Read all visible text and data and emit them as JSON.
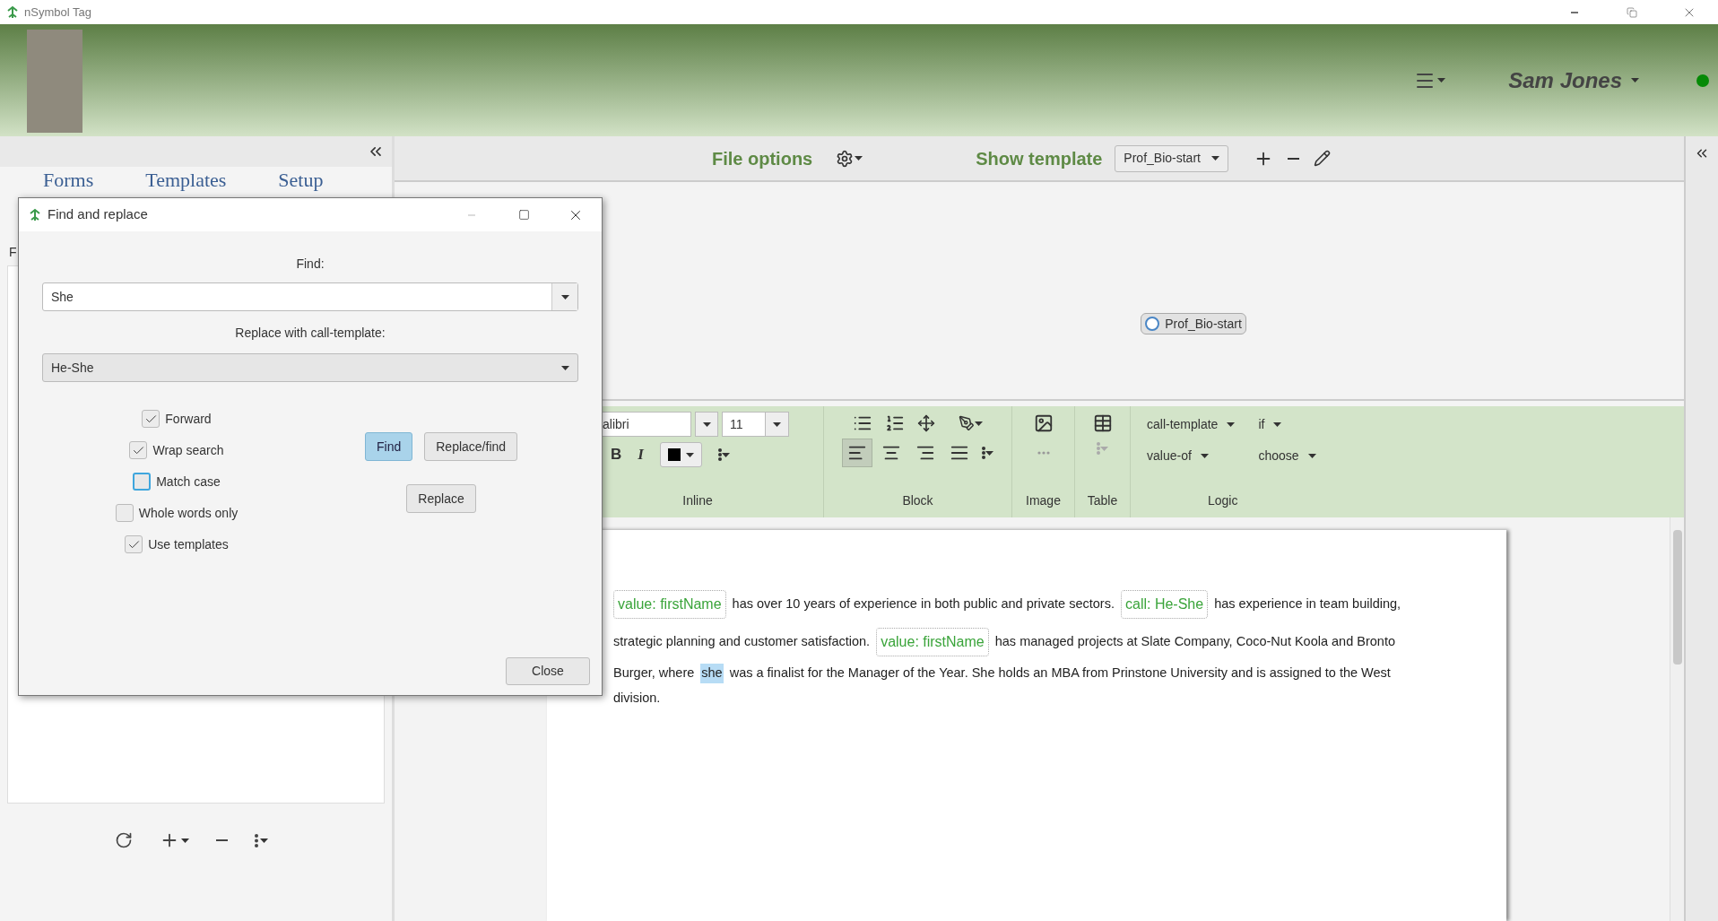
{
  "app_title": "nSymbol Tag",
  "header": {
    "user": "Sam Jones",
    "online": true
  },
  "left_panel": {
    "tabs": [
      "Forms",
      "Templates",
      "Setup"
    ],
    "partial_label": "F"
  },
  "main": {
    "file_options": "File options",
    "show_template": "Show template",
    "template_select": "Prof_Bio-start",
    "template_node": "Prof_Bio-start"
  },
  "toolbar": {
    "font": "alibri",
    "size": "11",
    "bold": "B",
    "italic": "I",
    "alignments": [
      {
        "kind": "left",
        "selected": true
      },
      {
        "kind": "center",
        "selected": false
      },
      {
        "kind": "right",
        "selected": false
      },
      {
        "kind": "justify",
        "selected": false
      }
    ],
    "logic": [
      "call-template",
      "if",
      "value-of",
      "choose"
    ],
    "groups": [
      "Inline",
      "Block",
      "Image",
      "Table",
      "Logic"
    ]
  },
  "document": {
    "lines": [
      [
        {
          "kind": "chip",
          "text": "value: firstName"
        },
        {
          "kind": "text",
          "text": "has over 10 years of experience in both public and private sectors."
        },
        {
          "kind": "chip",
          "text": "call: He-She"
        },
        {
          "kind": "text",
          "text": "has experience in team building,"
        }
      ],
      [
        {
          "kind": "text",
          "text": "strategic planning and customer satisfaction."
        },
        {
          "kind": "chip",
          "text": "value: firstName"
        },
        {
          "kind": "text",
          "text": "has managed projects at Slate Company, Coco-Nut Koola and Bronto"
        }
      ],
      [
        {
          "kind": "text",
          "text": "Burger, where"
        },
        {
          "kind": "match",
          "text": "she"
        },
        {
          "kind": "text",
          "text": "was a finalist for the Manager of the Year. She holds an MBA from Prinstone University and is assigned to the West"
        }
      ],
      [
        {
          "kind": "text",
          "text": "division."
        }
      ]
    ]
  },
  "dialog": {
    "title": "Find and replace",
    "find_label": "Find:",
    "find_value": "She",
    "replace_label": "Replace with call-template:",
    "replace_value": "He-She",
    "options": [
      {
        "label": "Forward",
        "checked": true,
        "focused": false
      },
      {
        "label": "Wrap search",
        "checked": true,
        "focused": false
      },
      {
        "label": "Match case",
        "checked": false,
        "focused": true
      },
      {
        "label": "Whole words only",
        "checked": false,
        "focused": false
      },
      {
        "label": "Use templates",
        "checked": true,
        "focused": false
      }
    ],
    "find_button": {
      "label": "Find",
      "default": true
    },
    "replace_find_button": {
      "label": "Replace/find",
      "default": false
    },
    "replace_button": {
      "label": "Replace",
      "default": false
    },
    "close_button": "Close"
  }
}
